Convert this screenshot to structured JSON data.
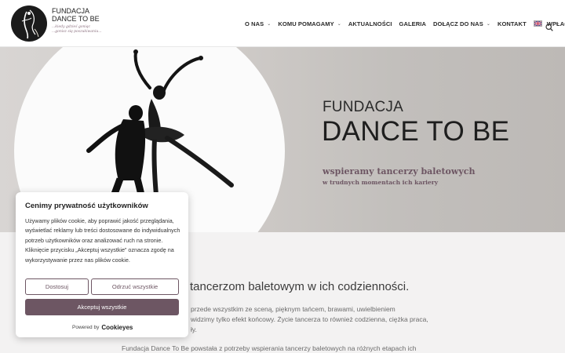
{
  "header": {
    "logo": {
      "line1": "FUNDACJA",
      "line2": "DANCE TO BE",
      "sub1": "...kiedy gdzieś goniąc",
      "sub2": "...gonisz się poszukiwaniu..."
    },
    "nav": [
      {
        "label": "O NAS",
        "has_dropdown": true
      },
      {
        "label": "KOMU POMAGAMY",
        "has_dropdown": true
      },
      {
        "label": "AKTUALNOŚCI",
        "has_dropdown": false
      },
      {
        "label": "GALERIA",
        "has_dropdown": false
      },
      {
        "label": "DOŁĄCZ DO NAS",
        "has_dropdown": true
      },
      {
        "label": "KONTAKT",
        "has_dropdown": false
      },
      {
        "label": "WPŁAĆ",
        "has_dropdown": false
      }
    ],
    "language_flag": "uk-flag-icon",
    "search_icon": "search-icon",
    "chevron": "⌄"
  },
  "hero": {
    "title_small": "FUNDACJA",
    "title_big": "DANCE TO BE",
    "tagline": "wspieramy tancerzy baletowych",
    "tagline_sub": "w trudnych momentach ich kariery",
    "accent_color": "#6d5663"
  },
  "content": {
    "heading": "tancerzom baletowym w ich codzienności.",
    "p1_l1": "przede wszystkim ze sceną, pięknym tańcem, brawami, uwielbieniem",
    "p1_l2": "widzimy tylko efekt końcowy. Życie tancerza to również codzienna, ciężka praca,",
    "p1_l3": "ły.",
    "p2_l1": "Fundacja Dance To Be powstała z potrzeby wspierania tancerzy baletowych na różnych etapach ich"
  },
  "cookie_banner": {
    "title": "Cenimy prywatność użytkowników",
    "text": "Używamy plików cookie, aby poprawić jakość przeglądania, wyświetlać reklamy lub treści dostosowane do indywidualnych potrzeb użytkowników oraz analizować ruch na stronie. Kliknięcie przycisku „Akceptuj wszystkie” oznacza zgodę na wykorzystywanie przez nas plików cookie.",
    "customize_label": "Dostosuj",
    "reject_label": "Odrzuć wszystkie",
    "accept_label": "Akceptuj wszystkie",
    "powered_by": "Powered by",
    "brand": "Cookieyes"
  }
}
